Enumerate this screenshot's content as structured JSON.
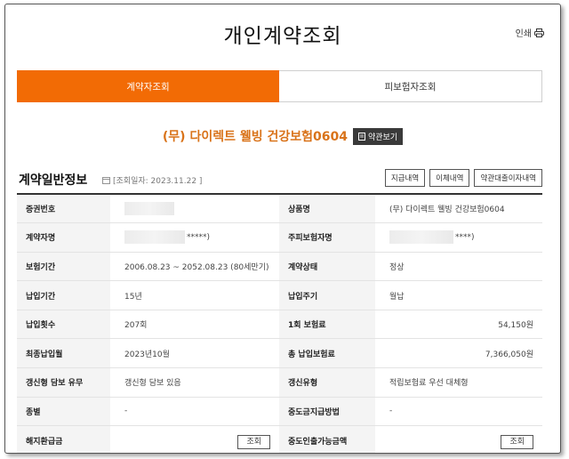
{
  "header": {
    "title": "개인계약조회",
    "print_label": "인쇄"
  },
  "tabs": [
    {
      "label": "계약자조회",
      "active": true
    },
    {
      "label": "피보험자조회",
      "active": false
    }
  ],
  "product": {
    "name": "(무) 다이렉트 웰빙 건강보험0604",
    "terms_button": "약관보기"
  },
  "section": {
    "title": "계약일반정보",
    "inquiry_date": "[조회일자: 2023.11.22 ]",
    "buttons": [
      "지급내역",
      "이체내역",
      "약관대출이자내역"
    ]
  },
  "rows": [
    {
      "l1": "증권번호",
      "v1": "",
      "l2": "상품명",
      "v2": "(무) 다이렉트 웰빙 건강보험0604"
    },
    {
      "l1": "계약자명",
      "v1": "*****)",
      "l2": "주피보험자명",
      "v2": "****)"
    },
    {
      "l1": "보험기간",
      "v1": "2006.08.23 ~ 2052.08.23 (80세만기)",
      "l2": "계약상태",
      "v2": "정상"
    },
    {
      "l1": "납입기간",
      "v1": "15년",
      "l2": "납입주기",
      "v2": "월납"
    },
    {
      "l1": "납입횟수",
      "v1": "207회",
      "l2": "1회 보험료",
      "v2": "54,150원"
    },
    {
      "l1": "최종납입월",
      "v1": "2023년10월",
      "l2": "총 납입보험료",
      "v2": "7,366,050원"
    },
    {
      "l1": "갱신형 담보 유무",
      "v1": "갱신형 담보 있음",
      "l2": "갱신유형",
      "v2": "적립보험료 우선 대체형"
    },
    {
      "l1": "종별",
      "v1": "-",
      "l2": "중도금지급방법",
      "v2": "-"
    },
    {
      "l1": "해지환급금",
      "v1": "조회",
      "l2": "중도인출가능금액",
      "v2": "조회"
    }
  ],
  "colors": {
    "accent": "#f26b05",
    "product_text": "#d9731a"
  }
}
